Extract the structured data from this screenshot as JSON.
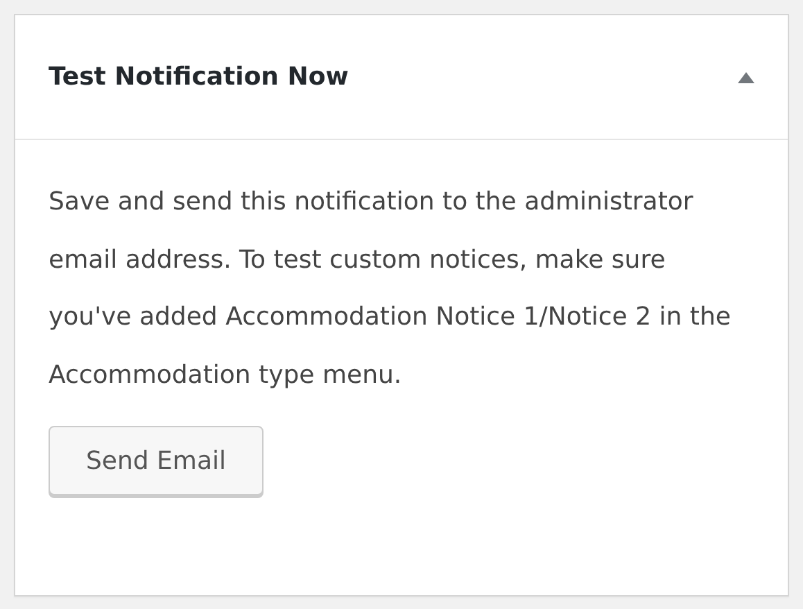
{
  "panel": {
    "title": "Test Notification Now",
    "expanded": true,
    "description": "Save and send this notification to the administrator email address. To test custom notices, make sure you've added Accommodation Notice 1/Notice 2 in the Accommodation type menu.",
    "button": "Send Email"
  }
}
